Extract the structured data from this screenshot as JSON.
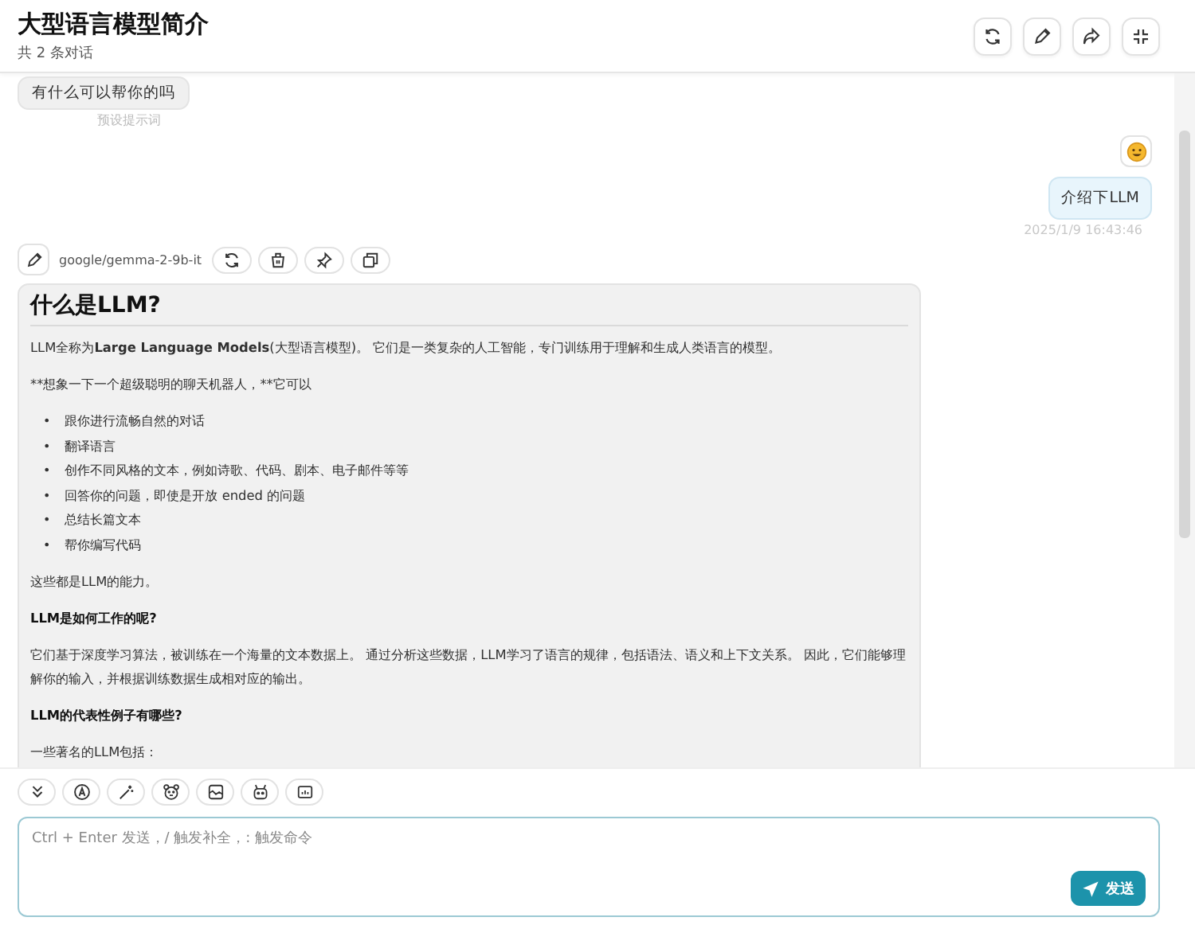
{
  "header": {
    "title": "大型语言模型简介",
    "subtitle": "共 2 条对话"
  },
  "preset_message": {
    "text": "有什么可以帮你的吗",
    "label": "预设提示词"
  },
  "user_message": {
    "text": "介绍下LLM",
    "time": "2025/1/9 16:43:46"
  },
  "bot_toolbar": {
    "model": "google/gemma-2-9b-it"
  },
  "bot_message": [
    {
      "kind": "heading",
      "text": "什么是LLM?"
    },
    {
      "kind": "rich",
      "text": "LLM全称为**Large Language Models**(大型语言模型)。 它们是一类复杂的人工智能，专门训练用于理解和生成人类语言的模型。"
    },
    {
      "kind": "paragraph",
      "text": "**想象一下一个超级聪明的聊天机器人，**它可以"
    },
    {
      "kind": "list",
      "marker": "•",
      "items": [
        "跟你进行流畅自然的对话",
        "翻译语言",
        "创作不同风格的文本，例如诗歌、代码、剧本、电子邮件等等",
        "回答你的问题，即使是开放 ended 的问题",
        "总结长篇文本",
        "帮你编写代码"
      ]
    },
    {
      "kind": "paragraph",
      "text": "这些都是LLM的能力。"
    },
    {
      "kind": "strong",
      "text": "LLM是如何工作的呢?"
    },
    {
      "kind": "paragraph",
      "text": "它们基于深度学习算法，被训练在一个海量的文本数据上。 通过分析这些数据，LLM学习了语言的规律，包括语法、语义和上下文关系。 因此，它们能够理解你的输入，并根据训练数据生成相对应的输出。"
    },
    {
      "kind": "strong",
      "text": "LLM的代表性例子有哪些?"
    },
    {
      "kind": "paragraph",
      "text": "一些著名的LLM包括："
    }
  ],
  "input": {
    "placeholder": "Ctrl + Enter 发送，/ 触发补全，: 触发命令",
    "send_label": "发送"
  }
}
